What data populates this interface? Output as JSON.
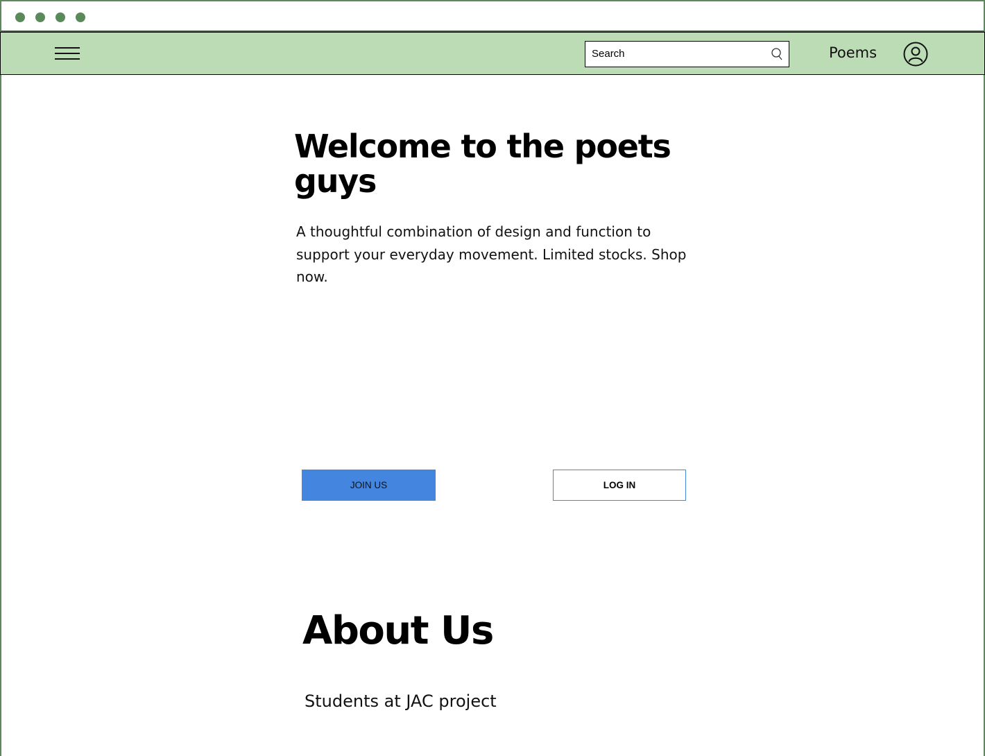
{
  "window": {
    "dots": [
      "window-dot",
      "window-dot",
      "window-dot",
      "window-dot"
    ]
  },
  "navbar": {
    "search_placeholder": "Search",
    "poems_label": "Poems",
    "menu_icon": "hamburger-menu-icon",
    "search_icon": "search-icon",
    "account_icon": "user-account-icon"
  },
  "hero": {
    "title": "Welcome to the poets guys",
    "description": "A thoughtful combination of design and function to support your everyday movement. Limited stocks. Shop now.",
    "join_label": "JOIN US",
    "login_label": "LOG IN"
  },
  "about": {
    "title": "About Us",
    "text": "Students at JAC project"
  },
  "colors": {
    "frame": "#5a8a5a",
    "navbar_bg": "#bcdcb6",
    "primary_button": "#4485e0",
    "window_dot": "#5a8a5a"
  }
}
